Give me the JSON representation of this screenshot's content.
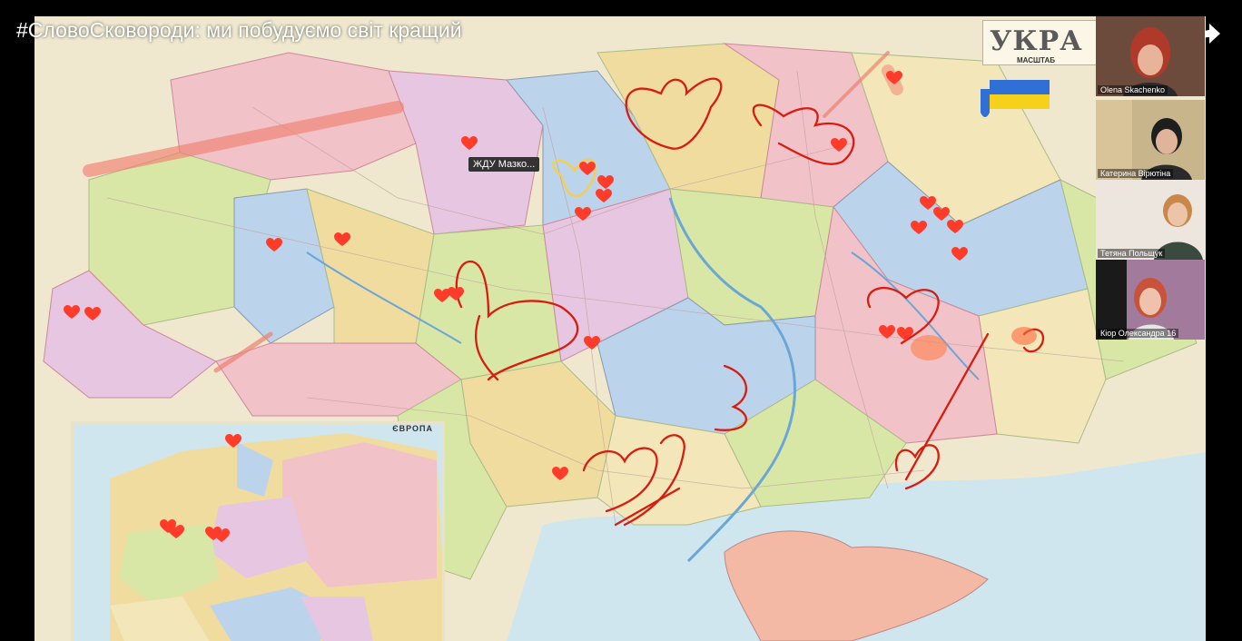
{
  "video": {
    "title": "#СловоСковороди: ми побудуємо світ кращий",
    "icons": {
      "clock": "watch-later-icon",
      "share": "share-icon"
    }
  },
  "map": {
    "title": "УКРА",
    "scale_label": "МАСШТАБ",
    "europe_inset_title": "ЄВРОПА",
    "tooltip": "ЖДУ Мазко..."
  },
  "participants": [
    {
      "name": "Olena Skachenko"
    },
    {
      "name": "Катерина Вірютіна"
    },
    {
      "name": "Тетяна Польщук"
    },
    {
      "name": "Кіор Олександра 16"
    }
  ],
  "colors": {
    "annotation": "#d81c10",
    "heart": "#ff3b2a",
    "highlight": "#ffcf30"
  }
}
